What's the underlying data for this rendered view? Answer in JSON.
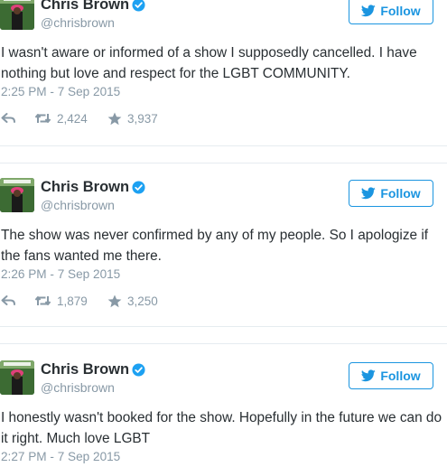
{
  "colors": {
    "accent": "#1b95e0",
    "text": "#292f33",
    "muted": "#8899a6",
    "verified": "#1da1f2",
    "avatar_bg": "#2f5a2a"
  },
  "icons": {
    "reply": "reply-arrow-icon",
    "retweet": "retweet-icon",
    "like": "star-icon",
    "verified": "verified-badge-icon",
    "follow": "twitter-bird-icon"
  },
  "tweets": [
    {
      "name": "Chris Brown",
      "handle": "@chrisbrown",
      "follow_label": "Follow",
      "text": "I wasn't aware or informed of a show I supposedly cancelled. I have nothing but love and respect for the LGBT COMMUNITY.",
      "timestamp": "2:25 PM - 7 Sep 2015",
      "retweets": "2,424",
      "likes": "3,937"
    },
    {
      "name": "Chris Brown",
      "handle": "@chrisbrown",
      "follow_label": "Follow",
      "text": "The show was never confirmed by any of my people. So I apologize if the fans wanted me there.",
      "timestamp": "2:26 PM - 7 Sep 2015",
      "retweets": "1,879",
      "likes": "3,250"
    },
    {
      "name": "Chris Brown",
      "handle": "@chrisbrown",
      "follow_label": "Follow",
      "text": "I honestly wasn't booked for the show. Hopefully in the future we can do it right.  Much love LGBT",
      "timestamp": "2:27 PM - 7 Sep 2015"
    }
  ]
}
